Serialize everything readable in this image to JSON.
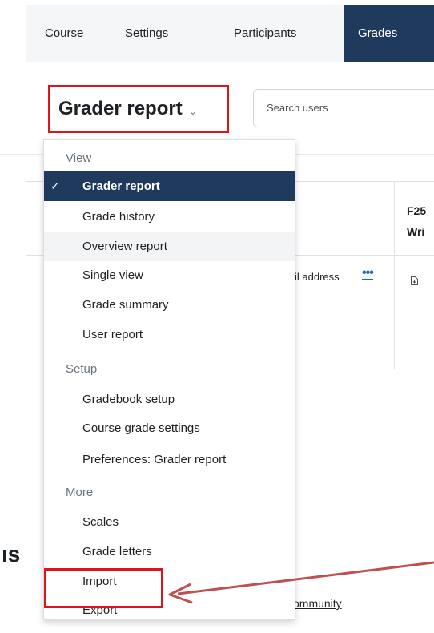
{
  "nav": {
    "tabs": [
      {
        "label": "Course"
      },
      {
        "label": "Settings"
      },
      {
        "label": "Participants"
      },
      {
        "label": "Grades"
      }
    ]
  },
  "header": {
    "report_selector_label": "Grader report",
    "search_placeholder": "Search users"
  },
  "table": {
    "column_header_line1": "F25",
    "column_header_line2": "Wri",
    "email_label": "il address"
  },
  "dropdown": {
    "groups": [
      {
        "label": "View",
        "items": [
          {
            "label": "Grader report",
            "selected": true
          },
          {
            "label": "Grade history"
          },
          {
            "label": "Overview report"
          },
          {
            "label": "Single view"
          },
          {
            "label": "Grade summary"
          },
          {
            "label": "User report"
          }
        ]
      },
      {
        "label": "Setup",
        "items": [
          {
            "label": "Gradebook setup"
          },
          {
            "label": "Course grade settings"
          },
          {
            "label": "Preferences: Grader report"
          }
        ]
      },
      {
        "label": "More",
        "items": [
          {
            "label": "Scales"
          },
          {
            "label": "Grade letters"
          },
          {
            "label": "Import"
          },
          {
            "label": "Export"
          }
        ]
      }
    ]
  },
  "footer": {
    "heading_fragment": "ıs",
    "link_fragment": "ommunity"
  },
  "colors": {
    "nav_active": "#1f3a5c",
    "highlight_red": "#e0121a",
    "arrow_red": "#c0504d"
  }
}
